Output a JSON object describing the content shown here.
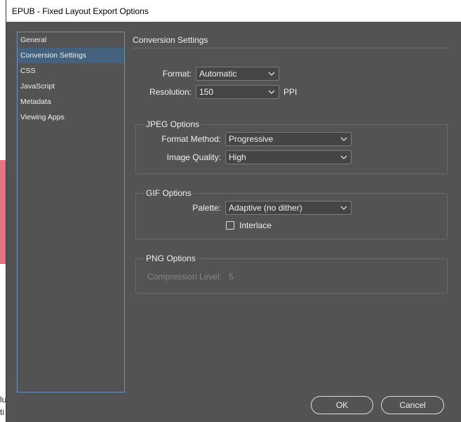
{
  "window": {
    "title": "EPUB - Fixed Layout Export Options"
  },
  "sidebar": {
    "items": [
      {
        "label": "General",
        "active": false
      },
      {
        "label": "Conversion Settings",
        "active": true
      },
      {
        "label": "CSS",
        "active": false
      },
      {
        "label": "JavaScript",
        "active": false
      },
      {
        "label": "Metadata",
        "active": false
      },
      {
        "label": "Viewing Apps",
        "active": false
      }
    ]
  },
  "panel": {
    "title": "Conversion Settings",
    "format": {
      "label": "Format:",
      "value": "Automatic"
    },
    "resolution": {
      "label": "Resolution:",
      "value": "150",
      "unit": "PPI"
    },
    "jpeg": {
      "title": "JPEG Options",
      "format_method": {
        "label": "Format Method:",
        "value": "Progressive"
      },
      "image_quality": {
        "label": "Image Quality:",
        "value": "High"
      }
    },
    "gif": {
      "title": "GIF Options",
      "palette": {
        "label": "Palette:",
        "value": "Adaptive (no dither)"
      },
      "interlace": {
        "label": "Interlace",
        "checked": false
      }
    },
    "png": {
      "title": "PNG Options",
      "compression": {
        "label": "Compression Level:",
        "value": "5",
        "disabled": true
      }
    }
  },
  "buttons": {
    "ok": "OK",
    "cancel": "Cancel"
  },
  "colors": {
    "dialog_bg": "#535353",
    "sidebar_active": "#44627e",
    "sidebar_border": "#6c92c2",
    "text": "#f0f0f0",
    "disabled_text": "#868686"
  }
}
